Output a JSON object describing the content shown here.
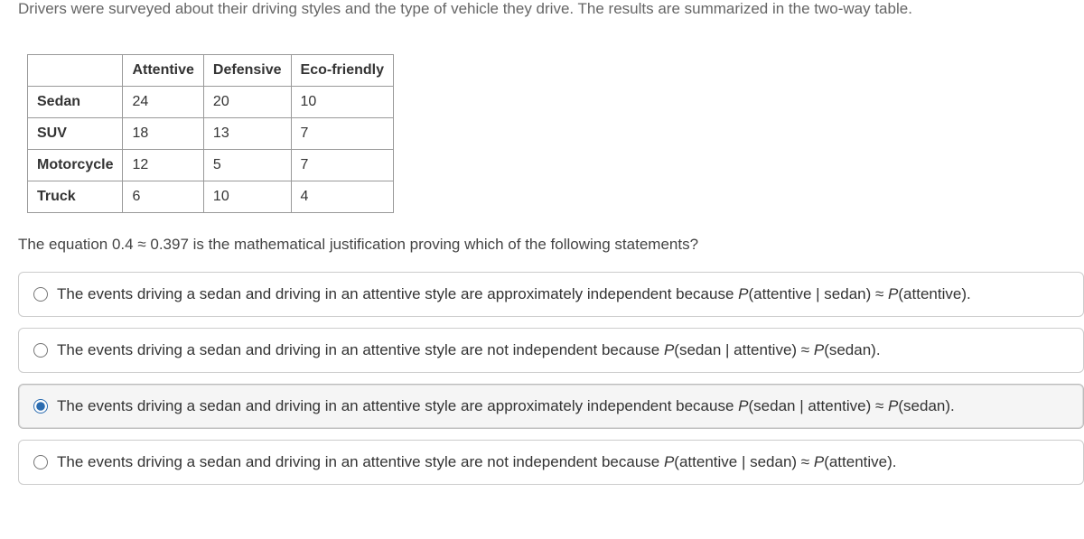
{
  "intro": "Drivers were surveyed about their driving styles and the type of vehicle they drive. The results are summarized in the two-way table.",
  "table": {
    "headers": [
      "",
      "Attentive",
      "Defensive",
      "Eco-friendly"
    ],
    "rows": [
      {
        "label": "Sedan",
        "values": [
          "24",
          "20",
          "10"
        ]
      },
      {
        "label": "SUV",
        "values": [
          "18",
          "13",
          "7"
        ]
      },
      {
        "label": "Motorcycle",
        "values": [
          "12",
          "5",
          "7"
        ]
      },
      {
        "label": "Truck",
        "values": [
          "6",
          "10",
          "4"
        ]
      }
    ]
  },
  "question": "The equation 0.4 ≈ 0.397 is the mathematical justification proving which of the following statements?",
  "options": [
    {
      "prefix": "The events driving a sedan and driving in an attentive style are approximately independent because ",
      "formula_lhs_func": "P",
      "formula_lhs_arg": "(attentive | sedan) ≈ ",
      "formula_rhs_func": "P",
      "formula_rhs_arg": "(attentive).",
      "selected": false
    },
    {
      "prefix": "The events driving a sedan and driving in an attentive style are not independent because ",
      "formula_lhs_func": "P",
      "formula_lhs_arg": "(sedan | attentive) ≈ ",
      "formula_rhs_func": "P",
      "formula_rhs_arg": "(sedan).",
      "selected": false
    },
    {
      "prefix": "The events driving a sedan and driving in an attentive style are approximately independent because ",
      "formula_lhs_func": "P",
      "formula_lhs_arg": "(sedan | attentive) ≈ ",
      "formula_rhs_func": "P",
      "formula_rhs_arg": "(sedan).",
      "selected": true
    },
    {
      "prefix": "The events driving a sedan and driving in an attentive style are not independent because ",
      "formula_lhs_func": "P",
      "formula_lhs_arg": "(attentive | sedan) ≈ ",
      "formula_rhs_func": "P",
      "formula_rhs_arg": "(attentive).",
      "selected": false
    }
  ]
}
